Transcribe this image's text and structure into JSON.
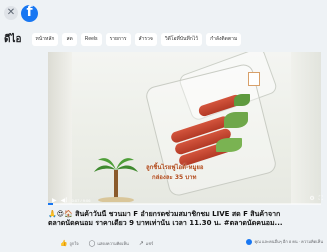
{
  "nav": {
    "title": "ดีไอ",
    "chips": [
      "หน้าหลัก",
      "สด",
      "Reels",
      "รายการ",
      "สำรวจ",
      "วิดีโอที่บันทึกไว้",
      "กำลังติดตาม"
    ]
  },
  "video": {
    "caption_line1": "ลูกชิ้นไรยฟูไอด์-หมูยอ",
    "caption_line2": "กล่องละ 35 บาท",
    "time": "0:07 / 9:06",
    "progress_fraction": 0.02
  },
  "post": {
    "line1": "🙏😍🏠 สินค้าวันนี้ ชวนมา F อำยกรดซ่วมสมาชิกชม LIVE สด F สินค้าจาก",
    "line2": "ตลาดนัดคนอม ราคาเดียว 9 บาทเท่านั้น เวลา 11.30 น. #ตลาดนัดคนอม..."
  },
  "actions": {
    "like": "ถูกใจ",
    "comment": "แสดงความคิดเห็น",
    "share": "แชร์",
    "reactions": "คุณ และคนอื่นๆ อีก 8 คน · ความคิดเห็น"
  },
  "colors": {
    "background": "#eef2f5",
    "facebook_blue": "#1877f2",
    "caption_orange": "#b04a1a"
  },
  "icons": [
    "close-icon",
    "facebook-logo",
    "play-icon",
    "volume-icon",
    "settings-icon",
    "fullscreen-icon",
    "like-icon",
    "comment-icon",
    "share-icon"
  ]
}
